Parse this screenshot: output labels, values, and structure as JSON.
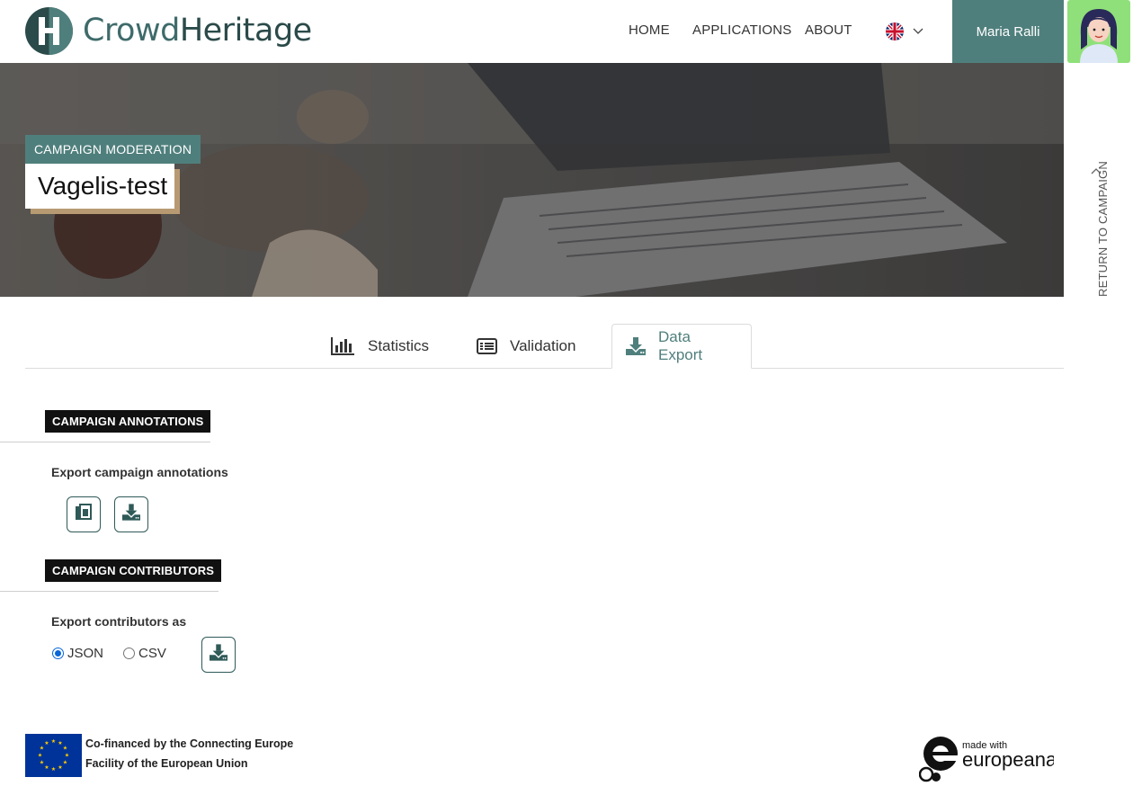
{
  "header": {
    "logo_part1": "Crowd",
    "logo_part2": "Heritage",
    "nav": [
      "HOME",
      "APPLICATIONS",
      "ABOUT"
    ],
    "language_icon": "uk-flag-icon",
    "user_name": "Maria Ralli"
  },
  "hero": {
    "label": "CAMPAIGN MODERATION",
    "title": "Vagelis-test",
    "return_link": "RETURN TO CAMPAIGN"
  },
  "tabs": [
    {
      "label": "Statistics",
      "icon": "bar-chart-icon",
      "active": false
    },
    {
      "label": "Validation",
      "icon": "list-icon",
      "active": false
    },
    {
      "label": "Data Export",
      "icon": "download-icon",
      "active": true
    }
  ],
  "annotations": {
    "heading": "CAMPAIGN ANNOTATIONS",
    "subtitle": "Export campaign annotations",
    "buttons": [
      "copy-icon",
      "download-icon"
    ]
  },
  "contributors": {
    "heading": "CAMPAIGN CONTRIBUTORS",
    "subtitle": "Export contributors as",
    "formats": [
      "JSON",
      "CSV"
    ],
    "selected": "JSON"
  },
  "footer": {
    "eu_line1": "Co-financed by the Connecting Europe",
    "eu_line2": "Facility of the European Union",
    "europeana_small": "made with",
    "europeana_big": "europeana"
  },
  "colors": {
    "accent": "#4f7f7c",
    "dark": "#111111",
    "eu_blue": "#003399"
  }
}
